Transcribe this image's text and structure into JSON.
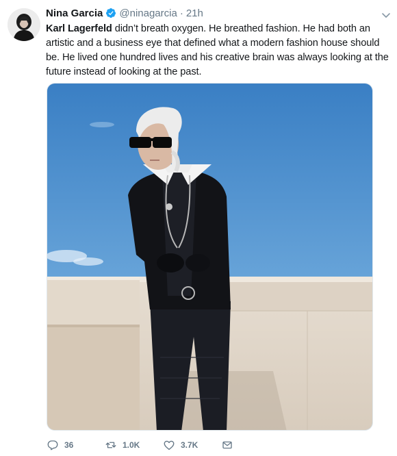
{
  "author": {
    "display_name": "Nina Garcia",
    "handle": "@ninagarcia",
    "separator": "·",
    "time": "21h",
    "verified": true
  },
  "tweet": {
    "mention": "Karl Lagerfeld",
    "text_rest": " didn’t breath oxygen. He breathed fashion. He had both an artistic and a business eye that defined what a modern fashion house should be. He lived one hundred lives and his creative brain was always looking at the future instead of looking at the past."
  },
  "actions": {
    "replies": "36",
    "retweets": "1.0K",
    "likes": "3.7K"
  },
  "icons": {
    "verified": "verified-badge-icon",
    "caret": "chevron-down-icon",
    "reply": "reply-icon",
    "retweet": "retweet-icon",
    "like": "heart-icon",
    "dm": "envelope-icon"
  },
  "colors": {
    "verified": "#1da1f2",
    "secondary_text": "#657786",
    "primary_text": "#14171a",
    "sky": "#4f8fcb"
  }
}
